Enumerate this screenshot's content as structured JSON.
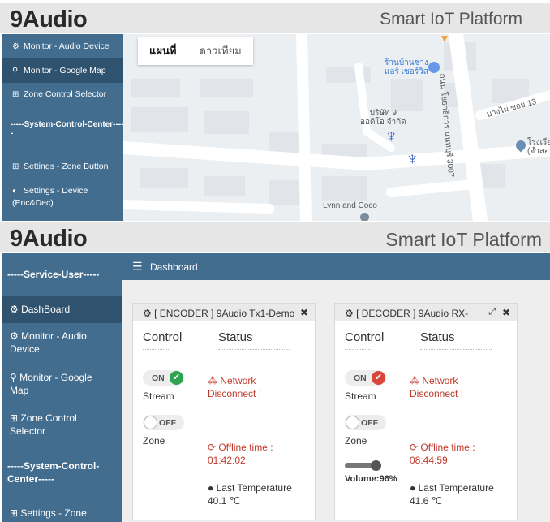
{
  "brand": {
    "logo": "9Audio",
    "platform": "Smart IoT Platform"
  },
  "top_sidebar": {
    "items": [
      {
        "icon": "dashboard-icon",
        "label": "Monitor - Audio Device"
      },
      {
        "icon": "map-marker-icon",
        "label": "Monitor - Google Map"
      },
      {
        "icon": "sitemap-icon",
        "label": "Zone Control Selector"
      }
    ],
    "section": "-----System-Control-Center-----",
    "items2": [
      {
        "icon": "sitemap-icon",
        "label": "Settings - Zone Button"
      },
      {
        "icon": "toggle-icon",
        "label": "Settings - Device (Enc&Dec)"
      }
    ]
  },
  "map": {
    "tab_map": "แผนที่",
    "tab_satellite": "ดาวเทียม",
    "labels": {
      "shop": "ร้านบ้านช่าง\nแอร์ เซอร์วิส",
      "company": "บริษัท 9\nออดิโอ จำกัด",
      "road1": "ถนน โยธาธิการ นนทบุรี 3007",
      "road2": "บางไผ่ ซอย 13",
      "school": "โรงเรีย\n(จำลอ",
      "place": "Lynn and Coco"
    }
  },
  "sidebar": {
    "section_user": "-----Service-User-----",
    "items": [
      {
        "icon": "dashboard-icon",
        "label": "DashBoard"
      },
      {
        "icon": "dashboard-icon",
        "label": "Monitor - Audio Device"
      },
      {
        "icon": "map-marker-icon",
        "label": "Monitor - Google Map"
      },
      {
        "icon": "sitemap-icon",
        "label": "Zone Control Selector"
      }
    ],
    "section_system": "-----System-Control-Center-----",
    "items2": [
      {
        "icon": "sitemap-icon",
        "label": "Settings - Zone"
      }
    ]
  },
  "topbar": {
    "title": "Dashboard"
  },
  "cards": [
    {
      "title": "[ ENCODER ] 9Audio Tx1-Demo",
      "control_header": "Control",
      "status_header": "Status",
      "stream_state": "ON",
      "stream_label": "Stream",
      "zone_state": "OFF",
      "zone_label": "Zone",
      "network": "Network Disconnect !",
      "offline_label": "Offline time :",
      "offline_time": "01:42:02",
      "temp_label": "Last Temperature",
      "temp_value": "40.1 ℃",
      "status_color": "#2ea44f"
    },
    {
      "title": "[ DECODER ] 9Audio RX-",
      "control_header": "Control",
      "status_header": "Status",
      "stream_state": "ON",
      "stream_label": "Stream",
      "zone_state": "OFF",
      "zone_label": "Zone",
      "volume_label": "Volume:96%",
      "volume": 96,
      "network": "Network Disconnect !",
      "offline_label": "Offline time :",
      "offline_time": "08:44:59",
      "temp_label": "Last Temperature",
      "temp_value": "41.6 ℃",
      "status_color": "#d9463b"
    }
  ]
}
